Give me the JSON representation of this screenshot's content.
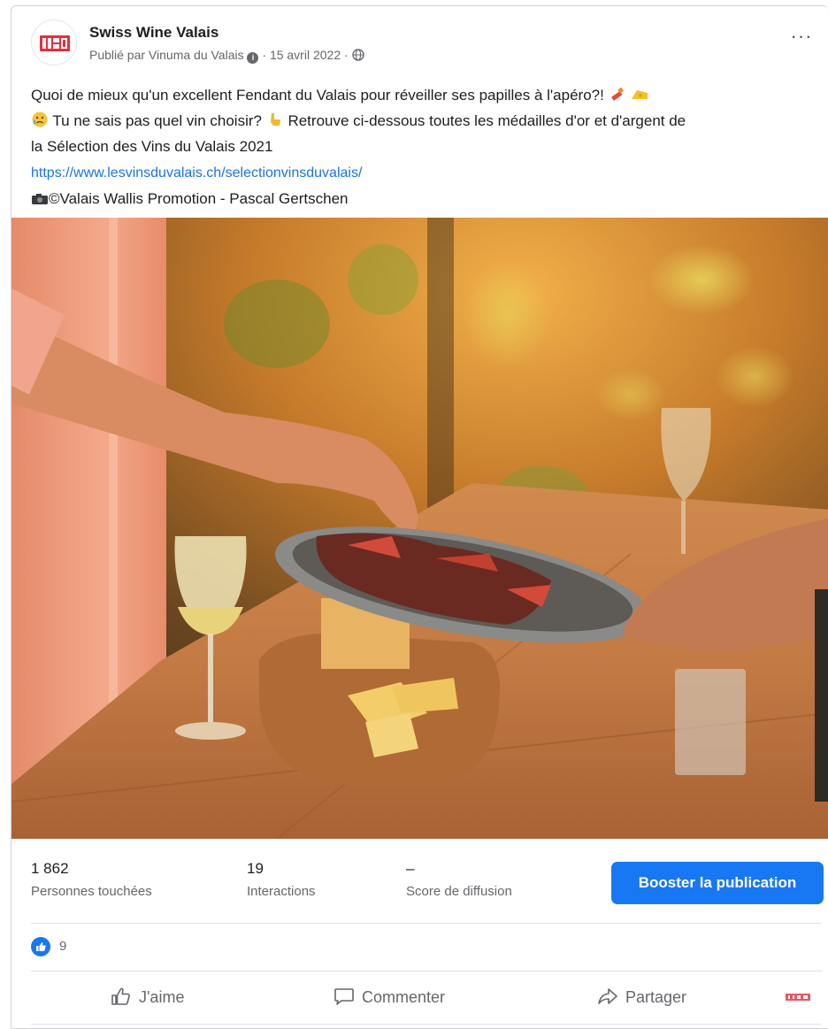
{
  "post": {
    "page_name": "Swiss Wine Valais",
    "published_by": "Publié par Vinuma du Valais",
    "date": "15 avril 2022",
    "separator": "·",
    "text_line1": "Quoi de mieux qu'un excellent Fendant du Valais pour réveiller ses papilles à l'apéro?!",
    "text_line2": "Tu ne sais pas quel vin choisir?",
    "text_line2b": "Retrouve ci-dessous toutes les médailles d'or et d'argent de",
    "text_line3": "la Sélection des Vins du Valais 2021",
    "link": "https://www.lesvinsduvalais.ch/selectionvinsduvalais/",
    "credit": "©Valais Wallis Promotion - Pascal Gertschen"
  },
  "more_label": "···",
  "stats": {
    "reach_value": "1 862",
    "reach_label": "Personnes touchées",
    "interactions_value": "19",
    "interactions_label": "Interactions",
    "score_value": "–",
    "score_label": "Score de diffusion"
  },
  "boost_label": "Booster la publication",
  "reactions": {
    "count": "9"
  },
  "actions": {
    "like": "J'aime",
    "comment": "Commenter",
    "share": "Partager"
  },
  "colors": {
    "accent": "#1877f2",
    "brand": "#e2303c",
    "link": "#1b74e4"
  },
  "icons": [
    "logo-icon",
    "info-icon",
    "globe-icon",
    "lipstick-emoji-icon",
    "cheese-emoji-icon",
    "sad-emoji-icon",
    "pointing-hand-icon",
    "camera-icon",
    "like-icon",
    "comment-icon",
    "share-icon"
  ]
}
